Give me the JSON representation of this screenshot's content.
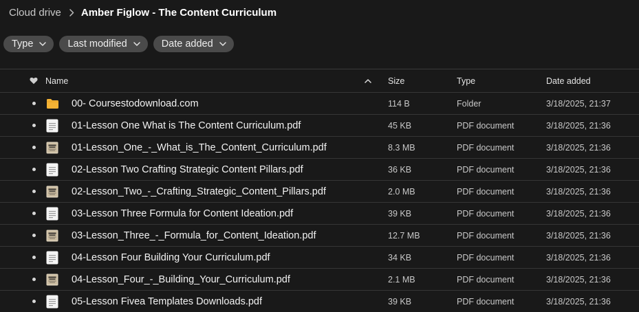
{
  "breadcrumb": {
    "root": "Cloud drive",
    "current": "Amber Figlow - The Content Curriculum"
  },
  "filters": [
    {
      "label": "Type"
    },
    {
      "label": "Last modified"
    },
    {
      "label": "Date added"
    }
  ],
  "columns": {
    "name": "Name",
    "size": "Size",
    "type": "Type",
    "date_added": "Date added"
  },
  "rows": [
    {
      "name": "00- Coursestodownload.com",
      "size": "114 B",
      "type": "Folder",
      "date_added": "3/18/2025, 21:37",
      "icon": "folder-icon"
    },
    {
      "name": "01-Lesson One What is The Content Curriculum.pdf",
      "size": "45 KB",
      "type": "PDF document",
      "date_added": "3/18/2025, 21:36",
      "icon": "document-icon"
    },
    {
      "name": "01-Lesson_One_-_What_is_The_Content_Curriculum.pdf",
      "size": "8.3 MB",
      "type": "PDF document",
      "date_added": "3/18/2025, 21:36",
      "icon": "pdf-thumbnail-icon"
    },
    {
      "name": "02-Lesson Two Crafting Strategic Content Pillars.pdf",
      "size": "36 KB",
      "type": "PDF document",
      "date_added": "3/18/2025, 21:36",
      "icon": "document-icon"
    },
    {
      "name": "02-Lesson_Two_-_Crafting_Strategic_Content_Pillars.pdf",
      "size": "2.0 MB",
      "type": "PDF document",
      "date_added": "3/18/2025, 21:36",
      "icon": "pdf-thumbnail-icon"
    },
    {
      "name": "03-Lesson Three Formula for Content Ideation.pdf",
      "size": "39 KB",
      "type": "PDF document",
      "date_added": "3/18/2025, 21:36",
      "icon": "document-icon"
    },
    {
      "name": "03-Lesson_Three_-_Formula_for_Content_Ideation.pdf",
      "size": "12.7 MB",
      "type": "PDF document",
      "date_added": "3/18/2025, 21:36",
      "icon": "pdf-thumbnail-icon"
    },
    {
      "name": "04-Lesson Four Building Your Curriculum.pdf",
      "size": "34 KB",
      "type": "PDF document",
      "date_added": "3/18/2025, 21:36",
      "icon": "document-icon"
    },
    {
      "name": "04-Lesson_Four_-_Building_Your_Curriculum.pdf",
      "size": "2.1 MB",
      "type": "PDF document",
      "date_added": "3/18/2025, 21:36",
      "icon": "pdf-thumbnail-icon"
    },
    {
      "name": "05-Lesson Fivea Templates Downloads.pdf",
      "size": "39 KB",
      "type": "PDF document",
      "date_added": "3/18/2025, 21:36",
      "icon": "document-icon"
    }
  ],
  "colors": {
    "background": "#191919",
    "chip": "#4a4a4a",
    "folder": "#f5b335",
    "divider": "#363636"
  }
}
